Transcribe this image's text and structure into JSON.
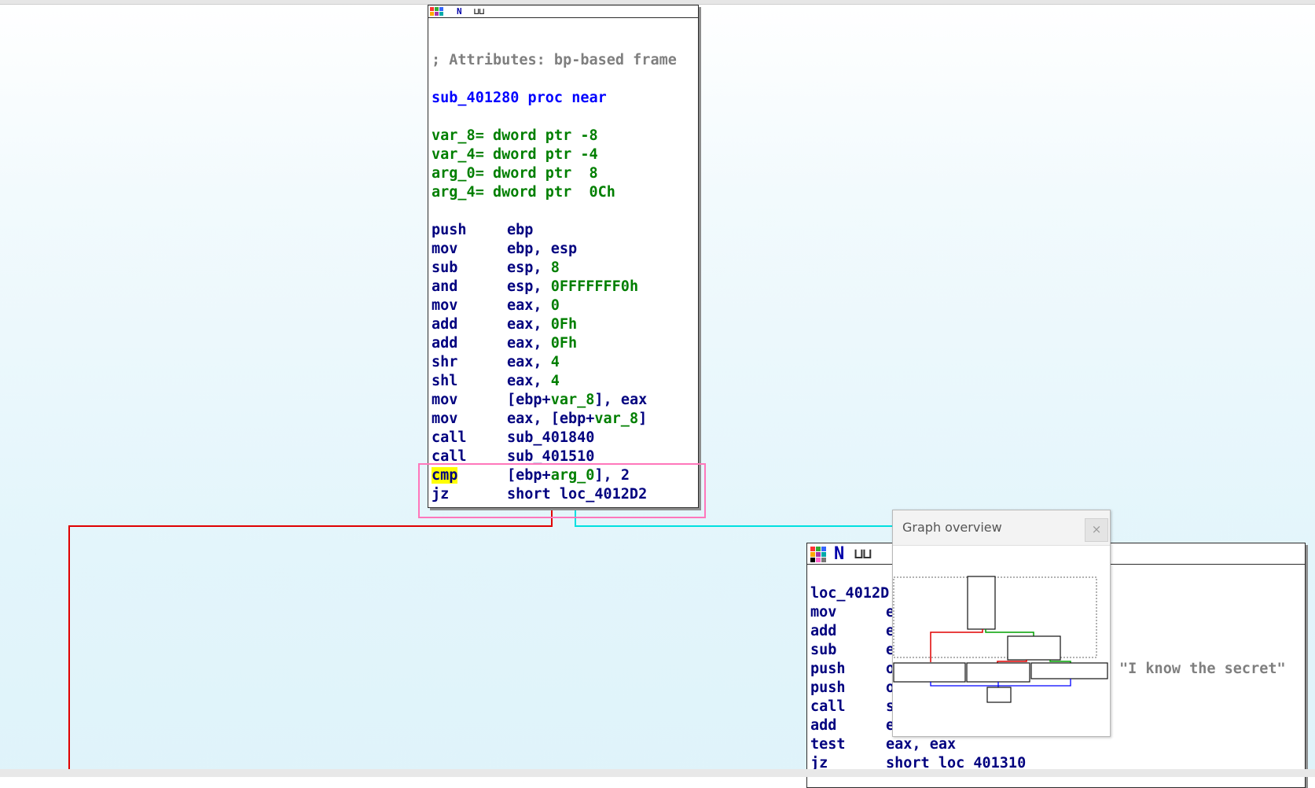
{
  "main_node": {
    "comment": "; Attributes: bp-based frame",
    "proc": "sub_401280 proc near",
    "vars": [
      {
        "name": "var_8",
        "eq": "= dword ptr",
        "val": " -8"
      },
      {
        "name": "var_4",
        "eq": "= dword ptr",
        "val": " -4"
      },
      {
        "name": "arg_0",
        "eq": "= dword ptr",
        "val": "  8"
      },
      {
        "name": "arg_4",
        "eq": "= dword ptr",
        "val": "  0Ch"
      }
    ],
    "instructions": {
      "i0": {
        "mn": "push",
        "a": "ebp"
      },
      "i1": {
        "mn": "mov",
        "a": "ebp, esp"
      },
      "i2": {
        "mn": "sub",
        "a": "esp, ",
        "b": "8"
      },
      "i3": {
        "mn": "and",
        "a": "esp, ",
        "b": "0FFFFFFF0h"
      },
      "i4": {
        "mn": "mov",
        "a": "eax, ",
        "b": "0"
      },
      "i5": {
        "mn": "add",
        "a": "eax, ",
        "b": "0Fh"
      },
      "i6": {
        "mn": "add",
        "a": "eax, ",
        "b": "0Fh"
      },
      "i7": {
        "mn": "shr",
        "a": "eax, ",
        "b": "4"
      },
      "i8": {
        "mn": "shl",
        "a": "eax, ",
        "b": "4"
      },
      "i9": {
        "mn": "mov",
        "a": "[ebp+",
        "b": "var_8",
        "c": "], eax"
      },
      "i10": {
        "mn": "mov",
        "a": "eax, [ebp+",
        "b": "var_8",
        "c": "]"
      },
      "i11": {
        "mn": "call",
        "a": "sub_401840"
      },
      "i12": {
        "mn": "call",
        "a": "sub_401510"
      },
      "i13": {
        "mn": "cmp",
        "a": "[ebp+",
        "b": "arg_0",
        "c": "], 2"
      },
      "i14": {
        "mn": "jz",
        "a": "short loc_4012D2"
      }
    }
  },
  "right_node": {
    "label": "loc_4012D",
    "lines": [
      {
        "mn": "mov",
        "a": "e"
      },
      {
        "mn": "add",
        "a": "e"
      },
      {
        "mn": "sub",
        "a": "e"
      },
      {
        "mn": "push",
        "a": "o"
      },
      {
        "mn": "push",
        "a": "o"
      },
      {
        "mn": "call",
        "a": "s"
      },
      {
        "mn": "add",
        "a": "e"
      },
      {
        "mn": "test",
        "a": "eax, eax"
      },
      {
        "mn": "jz",
        "a": "short loc_401310"
      }
    ],
    "string": "\"I know the secret\""
  },
  "overview": {
    "title": "Graph overview",
    "close": "×"
  },
  "colors": {
    "edge_false": "#e00000",
    "edge_true": "#00e0e0",
    "highlight": "#ffff00",
    "selection": "#ff77bb"
  }
}
